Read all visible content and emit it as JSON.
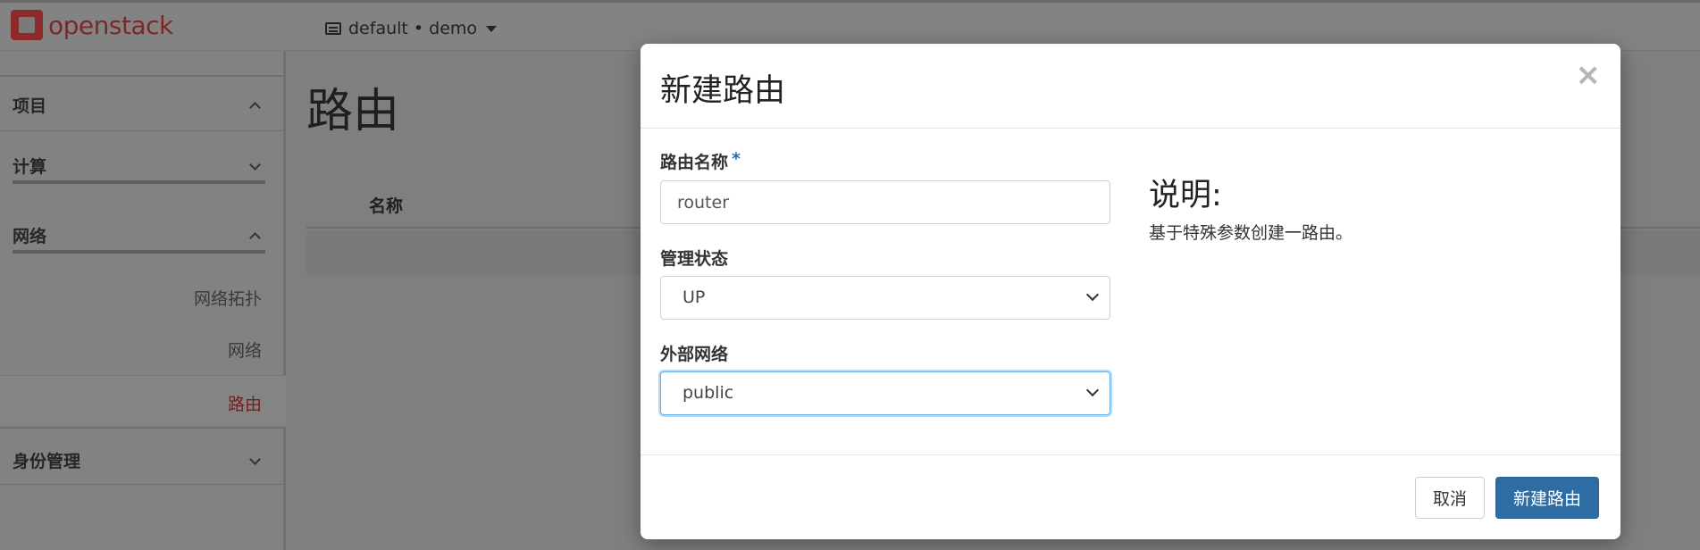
{
  "header": {
    "logo_text": "openstack",
    "project_switcher": "default • demo"
  },
  "sidebar": {
    "sections": [
      {
        "label": "项目",
        "state": "expanded"
      },
      {
        "label": "计算",
        "state": "collapsed"
      },
      {
        "label": "网络",
        "state": "expanded"
      },
      {
        "label": "身份管理",
        "state": "collapsed"
      }
    ],
    "items": [
      {
        "label": "网络拓扑"
      },
      {
        "label": "网络"
      },
      {
        "label": "路由",
        "active": true
      }
    ]
  },
  "main": {
    "title": "路由",
    "table": {
      "columns": [
        "名称"
      ]
    }
  },
  "modal": {
    "title": "新建路由",
    "close_glyph": "×",
    "fields": {
      "router_name": {
        "label": "路由名称",
        "required_mark": "*",
        "value": "router"
      },
      "admin_state": {
        "label": "管理状态",
        "value": "UP"
      },
      "external_network": {
        "label": "外部网络",
        "value": "public"
      }
    },
    "help": {
      "title": "说明:",
      "text": "基于特殊参数创建一路由。"
    },
    "buttons": {
      "cancel": "取消",
      "submit": "新建路由"
    }
  },
  "colors": {
    "primary_button": "#2e6da4",
    "active_nav": "#7a1c1c",
    "focus_ring": "#66afe9"
  }
}
